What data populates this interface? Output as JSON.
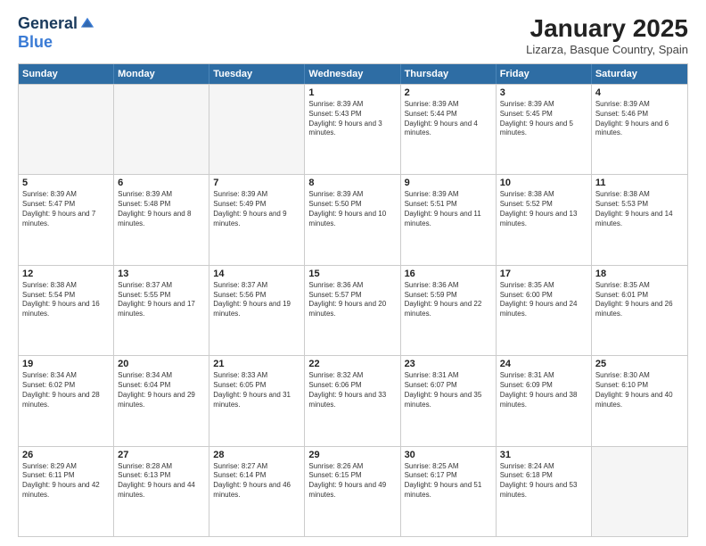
{
  "header": {
    "logo_general": "General",
    "logo_blue": "Blue",
    "month_title": "January 2025",
    "subtitle": "Lizarza, Basque Country, Spain"
  },
  "days_of_week": [
    "Sunday",
    "Monday",
    "Tuesday",
    "Wednesday",
    "Thursday",
    "Friday",
    "Saturday"
  ],
  "weeks": [
    [
      {
        "day": "",
        "empty": true
      },
      {
        "day": "",
        "empty": true
      },
      {
        "day": "",
        "empty": true
      },
      {
        "day": "1",
        "sunrise": "8:39 AM",
        "sunset": "5:43 PM",
        "daylight": "9 hours and 3 minutes."
      },
      {
        "day": "2",
        "sunrise": "8:39 AM",
        "sunset": "5:44 PM",
        "daylight": "9 hours and 4 minutes."
      },
      {
        "day": "3",
        "sunrise": "8:39 AM",
        "sunset": "5:45 PM",
        "daylight": "9 hours and 5 minutes."
      },
      {
        "day": "4",
        "sunrise": "8:39 AM",
        "sunset": "5:46 PM",
        "daylight": "9 hours and 6 minutes."
      }
    ],
    [
      {
        "day": "5",
        "sunrise": "8:39 AM",
        "sunset": "5:47 PM",
        "daylight": "9 hours and 7 minutes."
      },
      {
        "day": "6",
        "sunrise": "8:39 AM",
        "sunset": "5:48 PM",
        "daylight": "9 hours and 8 minutes."
      },
      {
        "day": "7",
        "sunrise": "8:39 AM",
        "sunset": "5:49 PM",
        "daylight": "9 hours and 9 minutes."
      },
      {
        "day": "8",
        "sunrise": "8:39 AM",
        "sunset": "5:50 PM",
        "daylight": "9 hours and 10 minutes."
      },
      {
        "day": "9",
        "sunrise": "8:39 AM",
        "sunset": "5:51 PM",
        "daylight": "9 hours and 11 minutes."
      },
      {
        "day": "10",
        "sunrise": "8:38 AM",
        "sunset": "5:52 PM",
        "daylight": "9 hours and 13 minutes."
      },
      {
        "day": "11",
        "sunrise": "8:38 AM",
        "sunset": "5:53 PM",
        "daylight": "9 hours and 14 minutes."
      }
    ],
    [
      {
        "day": "12",
        "sunrise": "8:38 AM",
        "sunset": "5:54 PM",
        "daylight": "9 hours and 16 minutes."
      },
      {
        "day": "13",
        "sunrise": "8:37 AM",
        "sunset": "5:55 PM",
        "daylight": "9 hours and 17 minutes."
      },
      {
        "day": "14",
        "sunrise": "8:37 AM",
        "sunset": "5:56 PM",
        "daylight": "9 hours and 19 minutes."
      },
      {
        "day": "15",
        "sunrise": "8:36 AM",
        "sunset": "5:57 PM",
        "daylight": "9 hours and 20 minutes."
      },
      {
        "day": "16",
        "sunrise": "8:36 AM",
        "sunset": "5:59 PM",
        "daylight": "9 hours and 22 minutes."
      },
      {
        "day": "17",
        "sunrise": "8:35 AM",
        "sunset": "6:00 PM",
        "daylight": "9 hours and 24 minutes."
      },
      {
        "day": "18",
        "sunrise": "8:35 AM",
        "sunset": "6:01 PM",
        "daylight": "9 hours and 26 minutes."
      }
    ],
    [
      {
        "day": "19",
        "sunrise": "8:34 AM",
        "sunset": "6:02 PM",
        "daylight": "9 hours and 28 minutes."
      },
      {
        "day": "20",
        "sunrise": "8:34 AM",
        "sunset": "6:04 PM",
        "daylight": "9 hours and 29 minutes."
      },
      {
        "day": "21",
        "sunrise": "8:33 AM",
        "sunset": "6:05 PM",
        "daylight": "9 hours and 31 minutes."
      },
      {
        "day": "22",
        "sunrise": "8:32 AM",
        "sunset": "6:06 PM",
        "daylight": "9 hours and 33 minutes."
      },
      {
        "day": "23",
        "sunrise": "8:31 AM",
        "sunset": "6:07 PM",
        "daylight": "9 hours and 35 minutes."
      },
      {
        "day": "24",
        "sunrise": "8:31 AM",
        "sunset": "6:09 PM",
        "daylight": "9 hours and 38 minutes."
      },
      {
        "day": "25",
        "sunrise": "8:30 AM",
        "sunset": "6:10 PM",
        "daylight": "9 hours and 40 minutes."
      }
    ],
    [
      {
        "day": "26",
        "sunrise": "8:29 AM",
        "sunset": "6:11 PM",
        "daylight": "9 hours and 42 minutes."
      },
      {
        "day": "27",
        "sunrise": "8:28 AM",
        "sunset": "6:13 PM",
        "daylight": "9 hours and 44 minutes."
      },
      {
        "day": "28",
        "sunrise": "8:27 AM",
        "sunset": "6:14 PM",
        "daylight": "9 hours and 46 minutes."
      },
      {
        "day": "29",
        "sunrise": "8:26 AM",
        "sunset": "6:15 PM",
        "daylight": "9 hours and 49 minutes."
      },
      {
        "day": "30",
        "sunrise": "8:25 AM",
        "sunset": "6:17 PM",
        "daylight": "9 hours and 51 minutes."
      },
      {
        "day": "31",
        "sunrise": "8:24 AM",
        "sunset": "6:18 PM",
        "daylight": "9 hours and 53 minutes."
      },
      {
        "day": "",
        "empty": true
      }
    ]
  ]
}
